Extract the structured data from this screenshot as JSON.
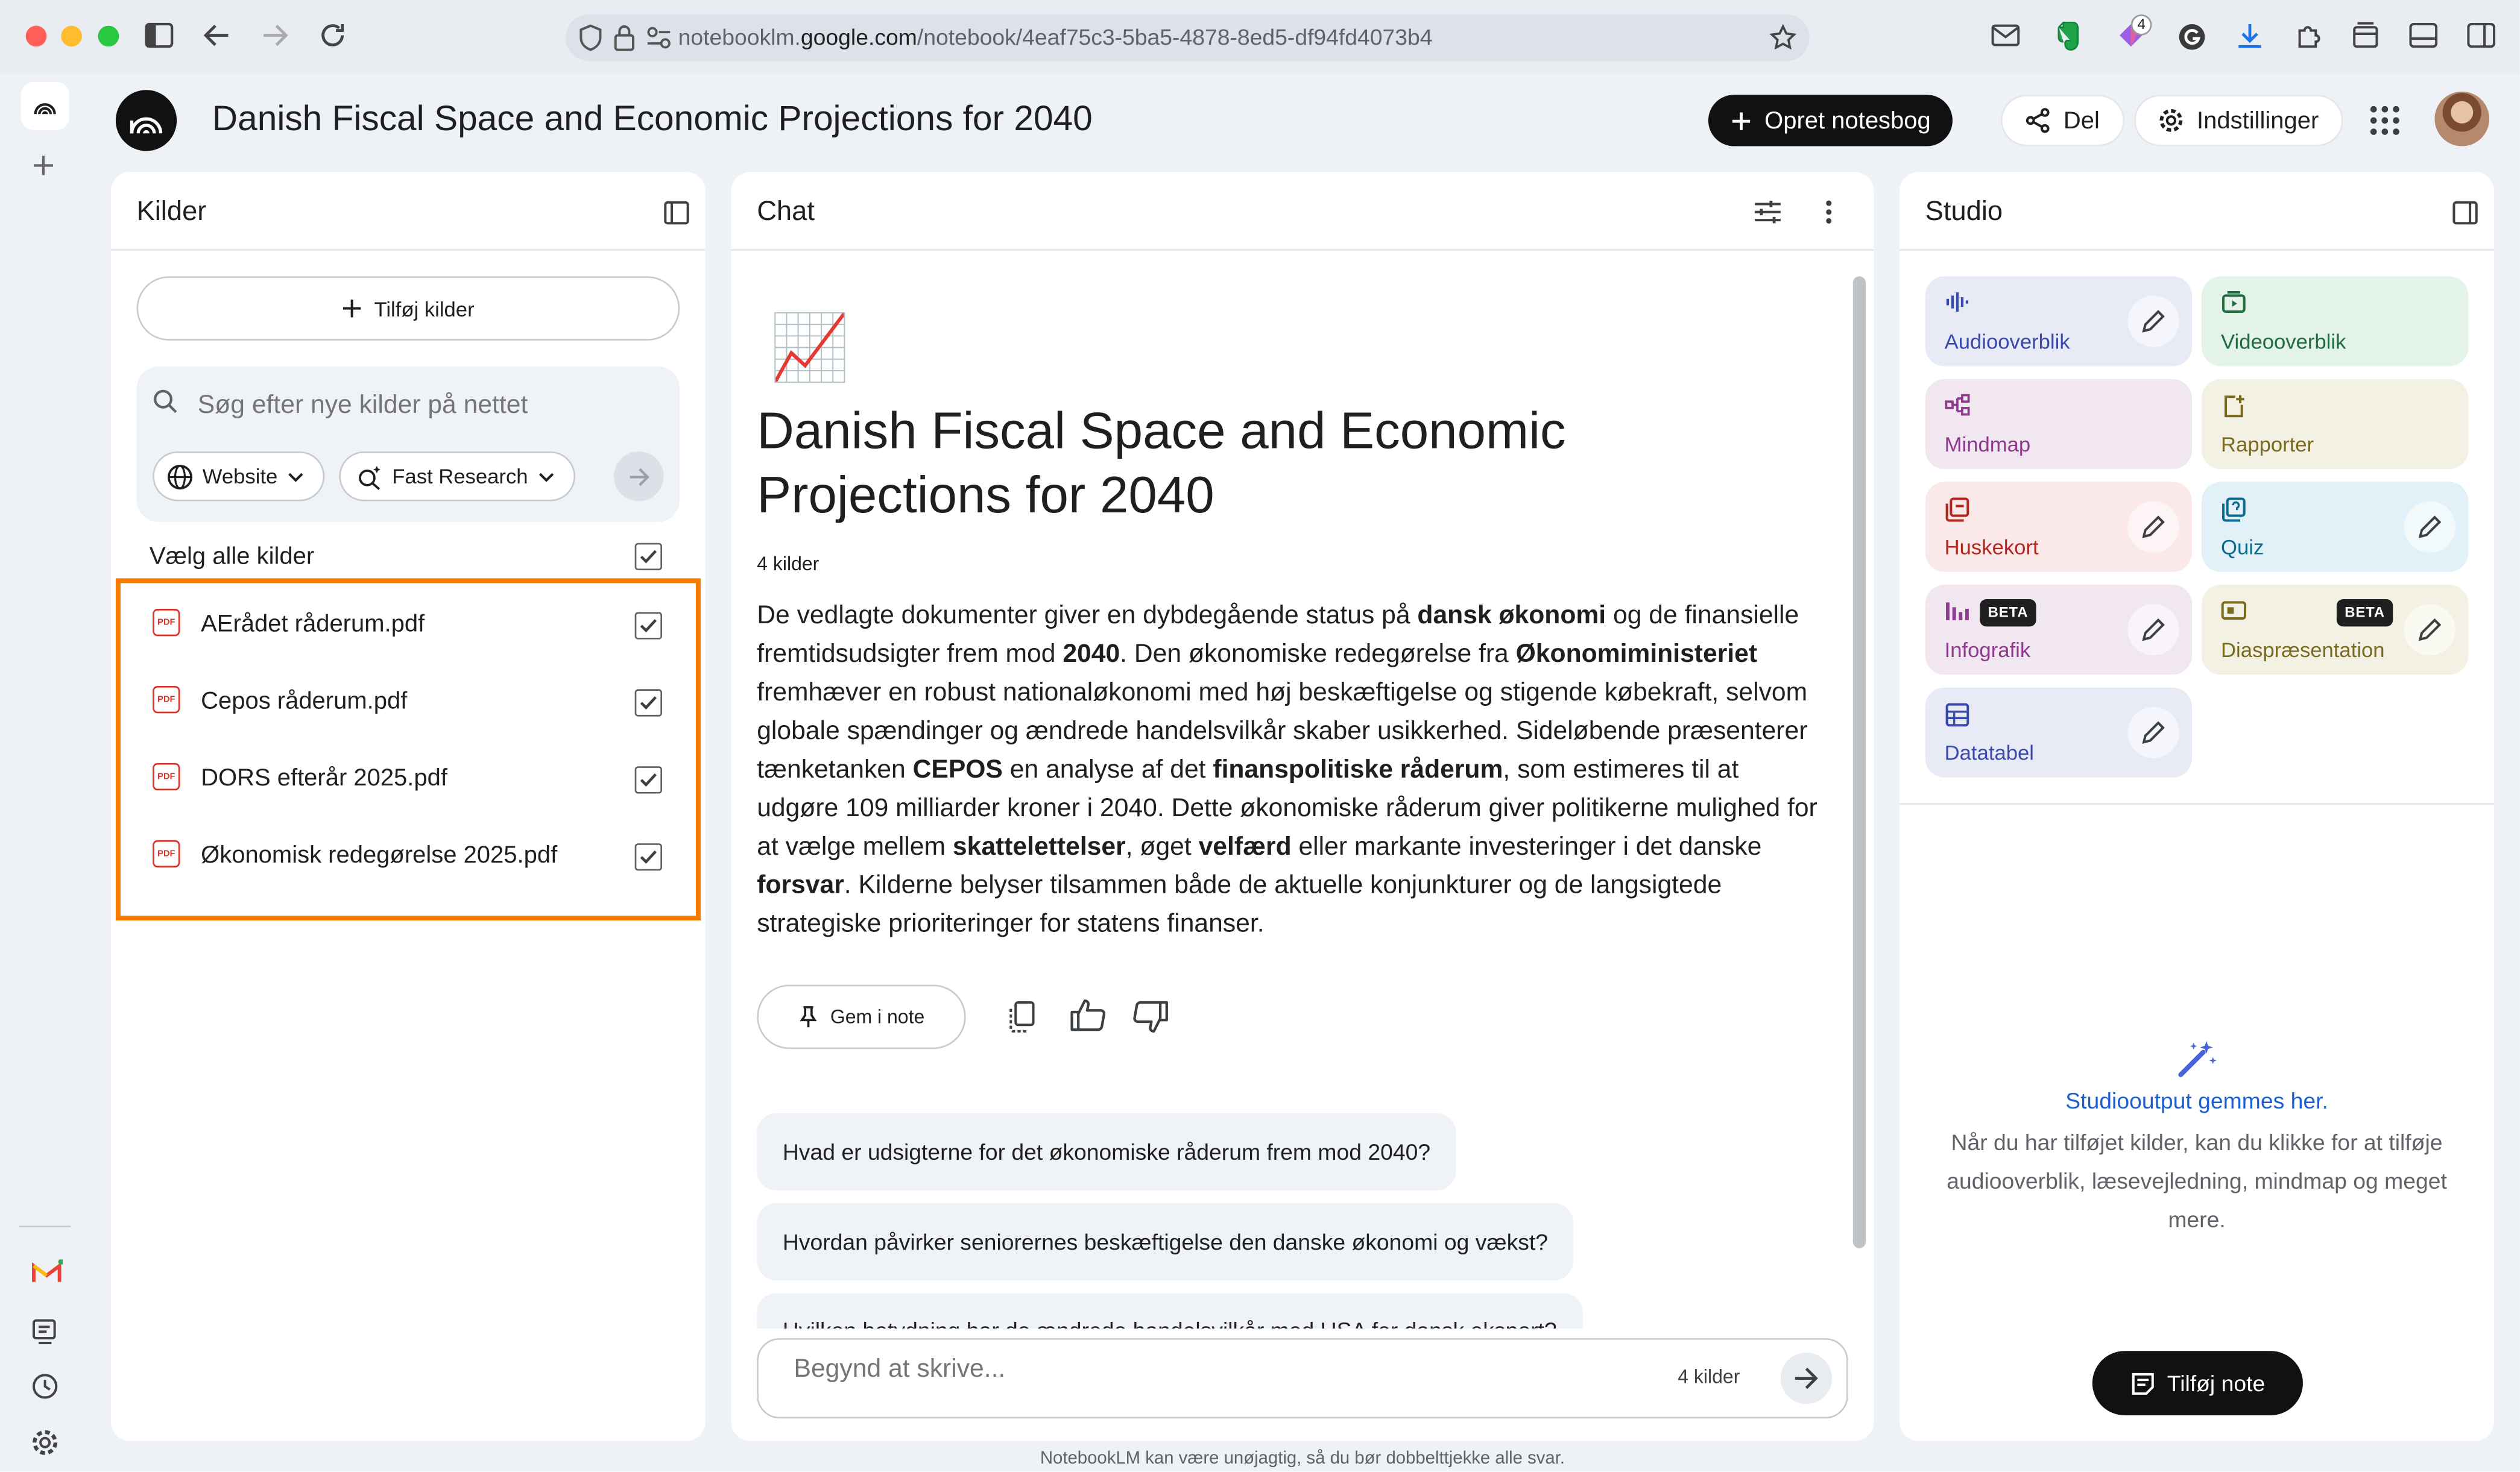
{
  "browser": {
    "url_prefix": "notebooklm.",
    "url_domain": "google.com",
    "url_path": "/notebook/4eaf75c3-5ba5-4878-8ed5-df94fd4073b4",
    "extension_badge": "4"
  },
  "header": {
    "title": "Danish Fiscal Space and Economic Projections for 2040",
    "create_button": "Opret notesbog",
    "share_button": "Del",
    "settings_button": "Indstillinger"
  },
  "sources": {
    "title": "Kilder",
    "add_button": "Tilføj kilder",
    "search_placeholder": "Søg efter nye kilder på nettet",
    "website_chip": "Website",
    "research_chip": "Fast Research",
    "select_all": "Vælg alle kilder",
    "items": [
      {
        "name": "AErådet råderum.pdf",
        "type": "PDF"
      },
      {
        "name": "Cepos råderum.pdf",
        "type": "PDF"
      },
      {
        "name": "DORS efterår 2025.pdf",
        "type": "PDF"
      },
      {
        "name": "Økonomisk redegørelse 2025.pdf",
        "type": "PDF"
      }
    ],
    "highlight_color": "#f57c00"
  },
  "chat": {
    "title": "Chat",
    "notebook_emoji": "📈",
    "heading_line1": "Danish Fiscal Space and Economic",
    "heading_line2": "Projections for 2040",
    "source_count": "4 kilder",
    "summary": [
      {
        "t": "De vedlagte dokumenter giver en dybdegående status på "
      },
      {
        "t": "dansk økonomi",
        "b": true
      },
      {
        "t": " og de finansielle fremtidsudsigter frem mod "
      },
      {
        "t": "2040",
        "b": true
      },
      {
        "t": ". Den økonomiske redegørelse fra "
      },
      {
        "t": "Økonomiministeriet",
        "b": true
      },
      {
        "t": " fremhæver en robust nationaløkonomi med høj beskæftigelse og stigende købekraft, selvom globale spændinger og ændrede handelsvilkår skaber usikkerhed. Sideløbende præsenterer tænketanken "
      },
      {
        "t": "CEPOS",
        "b": true
      },
      {
        "t": " en analyse af det "
      },
      {
        "t": "finanspolitiske råderum",
        "b": true
      },
      {
        "t": ", som estimeres til at udgøre 109 milliarder kroner i 2040. Dette økonomiske råderum giver politikerne mulighed for at vælge mellem "
      },
      {
        "t": "skattelettelser",
        "b": true
      },
      {
        "t": ", øget "
      },
      {
        "t": "velfærd",
        "b": true
      },
      {
        "t": " eller markante investeringer i det danske "
      },
      {
        "t": "forsvar",
        "b": true
      },
      {
        "t": ". Kilderne belyser tilsammen både de aktuelle konjunkturer og de langsigtede strategiske prioriteringer for statens finanser."
      }
    ],
    "save_note_button": "Gem i note",
    "suggestions": [
      "Hvad er udsigterne for det økonomiske råderum frem mod 2040?",
      "Hvordan påvirker seniorernes beskæftigelse den danske økonomi og vækst?",
      "Hvilken betydning har de ændrede handelsvilkår med USA for dansk eksport?"
    ],
    "input_placeholder": "Begynd at skrive...",
    "input_source_count": "4 kilder"
  },
  "studio": {
    "title": "Studio",
    "tiles": [
      {
        "label": "Audiooverblik",
        "bg": "#e8eaf6",
        "fg": "#3949ab"
      },
      {
        "label": "Videooverblik",
        "bg": "#e3f3ea",
        "fg": "#1e6b3c"
      },
      {
        "label": "Mindmap",
        "bg": "#f1e7f1",
        "fg": "#8e3b8e"
      },
      {
        "label": "Rapporter",
        "bg": "#f3f1e3",
        "fg": "#7a6a1e"
      },
      {
        "label": "Huskekort",
        "bg": "#fbe9e9",
        "fg": "#b3261e"
      },
      {
        "label": "Quiz",
        "bg": "#e1f1f7",
        "fg": "#0b6b8c"
      },
      {
        "label": "Infografik",
        "bg": "#f1e7f1",
        "fg": "#8e3b8e"
      },
      {
        "label": "Diaspræsentation",
        "bg": "#f3f1e3",
        "fg": "#7a6a1e"
      },
      {
        "label": "Datatabel",
        "bg": "#e8eaf6",
        "fg": "#3949ab"
      }
    ],
    "beta_label": "BETA",
    "empty_title": "Studiooutput gemmes her.",
    "empty_desc": "Når du har tilføjet kilder, kan du klikke for at tilføje audiooverblik, læsevejledning, mindmap og meget mere.",
    "add_note_button": "Tilføj note"
  },
  "footer": {
    "disclaimer": "NotebookLM kan være unøjagtig, så du bør dobbelttjekke alle svar."
  }
}
